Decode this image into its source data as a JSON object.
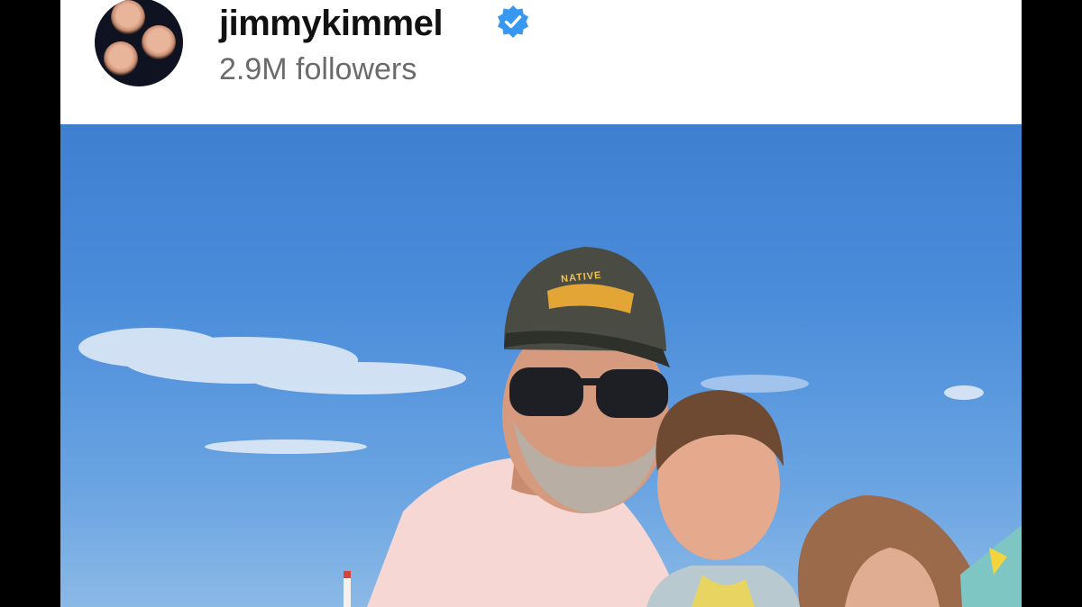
{
  "profile": {
    "username": "jimmykimmel",
    "followers": "2.9M followers",
    "verified": true
  },
  "icons": {
    "verified": "verified-badge-icon",
    "avatar": "profile-avatar"
  },
  "photo": {
    "hat_text": "NATIVE"
  },
  "colors": {
    "verified_blue": "#3897f0",
    "sky": "#4a8cda",
    "username": "#111111",
    "followers": "#6b6b6b"
  }
}
